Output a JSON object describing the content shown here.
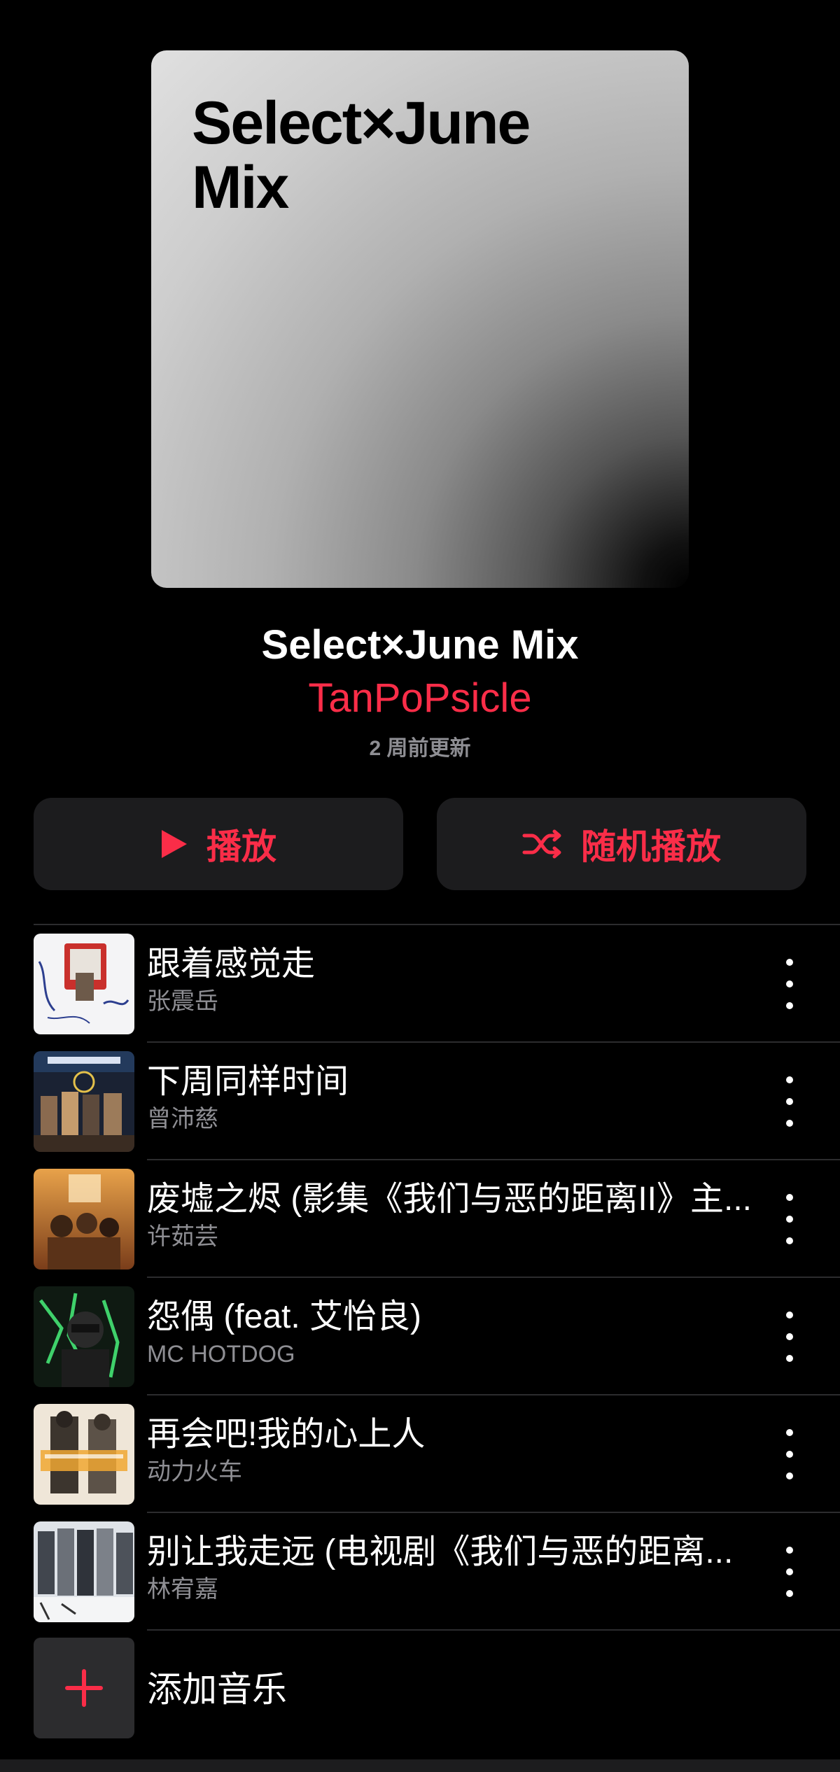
{
  "playlist": {
    "cover_title": "Select×June\nMix",
    "title": "Select×June Mix",
    "curator": "TanPoPsicle",
    "updated": "2 周前更新"
  },
  "actions": {
    "play_label": "播放",
    "shuffle_label": "随机播放",
    "accent_color": "#fa2d48"
  },
  "tracks": [
    {
      "title": "跟着感觉走",
      "artist": "张震岳"
    },
    {
      "title": "下周同样时间",
      "artist": "曾沛慈"
    },
    {
      "title": "废墟之烬 (影集《我们与恶的距离II》主...",
      "artist": "许茹芸"
    },
    {
      "title": "怨偶 (feat. 艾怡良)",
      "artist": "MC HOTDOG"
    },
    {
      "title": "再会吧!我的心上人",
      "artist": "动力火车"
    },
    {
      "title": "别让我走远 (电视剧《我们与恶的距离...",
      "artist": "林宥嘉"
    }
  ],
  "add_music": {
    "label": "添加音乐"
  },
  "icons": {
    "play": "play-icon",
    "shuffle": "shuffle-icon",
    "more": "more-vertical-icon",
    "add": "plus-icon"
  }
}
